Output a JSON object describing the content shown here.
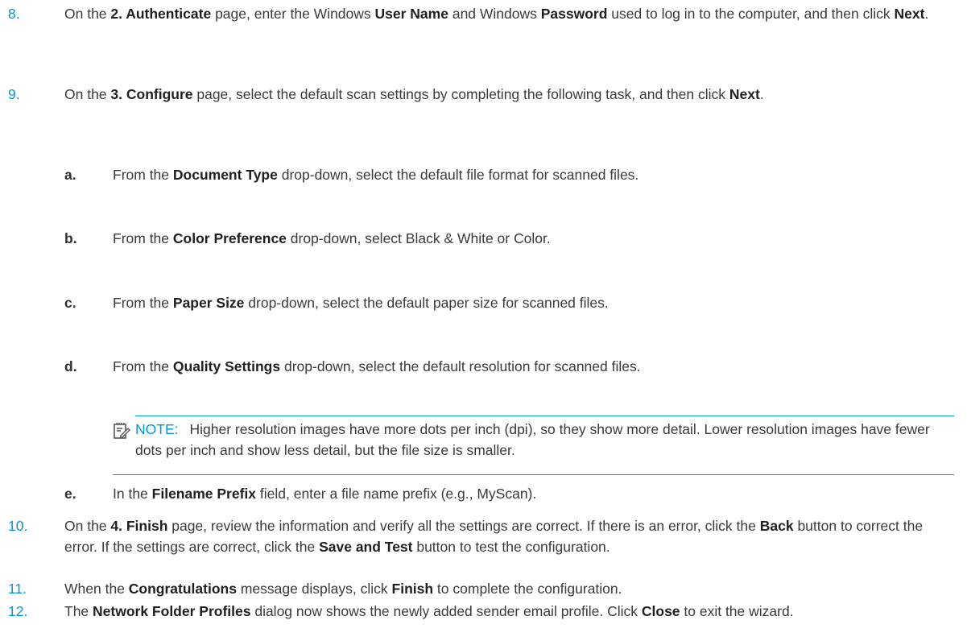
{
  "steps": {
    "s8": {
      "num": "8.",
      "t1": "On the ",
      "b1": "2. Authenticate",
      "t2": " page, enter the Windows ",
      "b2": "User Name",
      "t3": " and Windows ",
      "b3": "Password",
      "t4": " used to log in to the computer, and then click ",
      "b4": "Next",
      "t5": "."
    },
    "s9": {
      "num": "9.",
      "t1": "On the ",
      "b1": "3. Configure",
      "t2": " page, select the default scan settings by completing the following task, and then click ",
      "b2": "Next",
      "t3": "."
    },
    "sa": {
      "letter": "a.",
      "t1": "From the ",
      "b1": "Document Type",
      "t2": " drop-down, select the default file format for scanned files."
    },
    "sb": {
      "letter": "b.",
      "t1": "From the ",
      "b1": "Color Preference",
      "t2": " drop-down, select Black & White or Color."
    },
    "sc": {
      "letter": "c.",
      "t1": "From the ",
      "b1": "Paper Size",
      "t2": " drop-down, select the default paper size for scanned files."
    },
    "sd": {
      "letter": "d.",
      "t1": "From the ",
      "b1": "Quality Settings",
      "t2": " drop-down, select the default resolution for scanned files."
    },
    "note": {
      "icon": "note-icon",
      "label": "NOTE:",
      "text": "Higher resolution images have more dots per inch (dpi), so they show more detail. Lower resolution images have fewer dots per inch and show less detail, but the file size is smaller."
    },
    "se": {
      "letter": "e.",
      "t1": "In the ",
      "b1": "Filename Prefix",
      "t2": " field, enter a file name prefix (e.g., MyScan)."
    },
    "s10": {
      "num": "10.",
      "t1": "On the ",
      "b1": "4. Finish",
      "t2": " page, review the information and verify all the settings are correct. If there is an error, click the ",
      "b2": "Back",
      "t3": " button to correct the error. If the settings are correct, click the ",
      "b3": "Save and Test",
      "t4": " button to test the configuration."
    },
    "s11": {
      "num": "11.",
      "t1": "When the ",
      "b1": "Congratulations",
      "t2": " message displays, click ",
      "b2": "Finish",
      "t3": " to complete the configuration."
    },
    "s12": {
      "num": "12.",
      "t1": "The ",
      "b1": "Network Folder Profiles",
      "t2": " dialog now shows the newly added sender email profile. Click ",
      "b2": "Close",
      "t3": " to exit the wizard."
    }
  },
  "colors": {
    "accent": "#0096d6",
    "text": "#3a3a3a"
  }
}
